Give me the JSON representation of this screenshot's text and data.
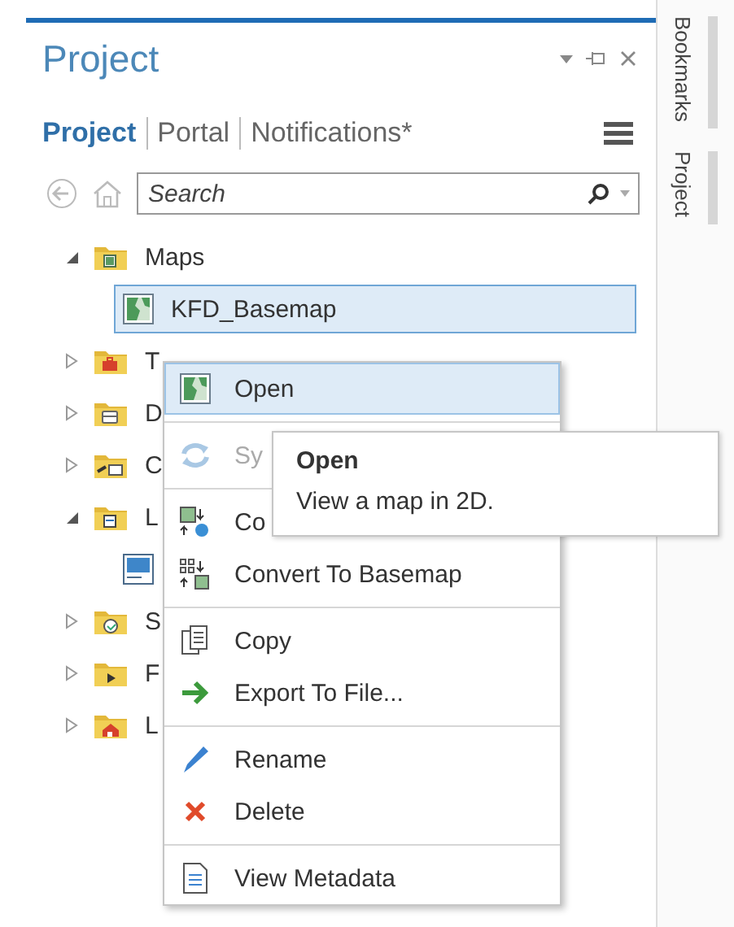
{
  "panel": {
    "title": "Project",
    "tabs": [
      {
        "label": "Project",
        "selected": true
      },
      {
        "label": "Portal",
        "selected": false
      },
      {
        "label": "Notifications*",
        "selected": false
      }
    ],
    "search": {
      "placeholder": "Search"
    }
  },
  "tree": [
    {
      "label": "Maps",
      "expanded": true,
      "selected": false,
      "children": [
        {
          "label": "KFD_Basemap",
          "selected": true
        }
      ]
    },
    {
      "label": "T",
      "expanded": false,
      "selected": false
    },
    {
      "label": "D",
      "expanded": false,
      "selected": false
    },
    {
      "label": "C",
      "expanded": false,
      "selected": false
    },
    {
      "label": "L",
      "expanded": true,
      "selected": false,
      "children": [
        {
          "selected": false
        }
      ]
    },
    {
      "label": "S",
      "expanded": false,
      "selected": false
    },
    {
      "label": "F",
      "expanded": false,
      "selected": false
    },
    {
      "label": "L",
      "expanded": false,
      "selected": false
    }
  ],
  "context_menu": {
    "groups": [
      [
        {
          "label": "Open",
          "selected": true,
          "disabled": false
        }
      ],
      [
        {
          "label": "Sy",
          "selected": false,
          "disabled": true
        }
      ],
      [
        {
          "label": "Co",
          "selected": false,
          "disabled": false
        },
        {
          "label": "Convert To Basemap",
          "selected": false,
          "disabled": false
        }
      ],
      [
        {
          "label": "Copy",
          "selected": false,
          "disabled": false
        },
        {
          "label": "Export To File...",
          "selected": false,
          "disabled": false
        }
      ],
      [
        {
          "label": "Rename",
          "selected": false,
          "disabled": false
        },
        {
          "label": "Delete",
          "selected": false,
          "disabled": false
        }
      ],
      [
        {
          "label": "View Metadata",
          "selected": false,
          "disabled": false
        }
      ]
    ]
  },
  "tooltip": {
    "title": "Open",
    "text": "View a map in 2D."
  },
  "side_tabs": [
    {
      "label": "Bookmarks"
    },
    {
      "label": "Project"
    }
  ]
}
